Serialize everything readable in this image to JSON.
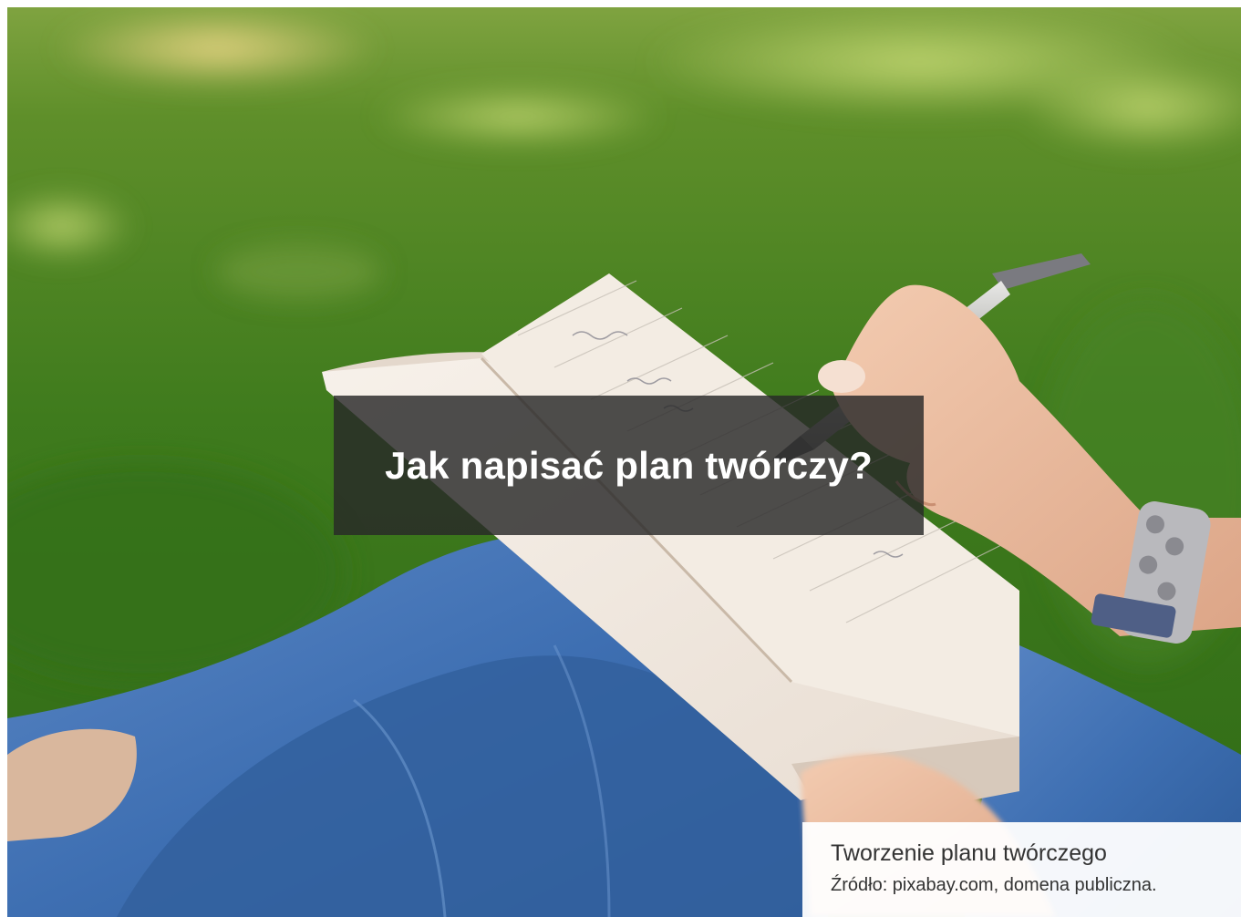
{
  "hero": {
    "title": "Jak napisać plan twórczy?",
    "image_description_icon": "photo-writing-notebook"
  },
  "caption": {
    "title": "Tworzenie planu twórczego",
    "source": "Źródło: pixabay.com, domena publiczna."
  },
  "colors": {
    "overlay": "#282828",
    "caption_bg": "#ffffff",
    "caption_text": "#333333",
    "title_text": "#ffffff",
    "grass": "#3f7a1c"
  }
}
